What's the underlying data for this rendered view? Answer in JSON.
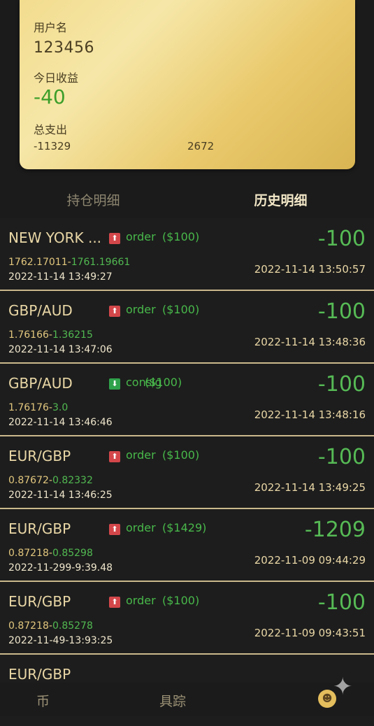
{
  "card": {
    "username_label": "用户名",
    "username_value": "123456",
    "today_label": "今日收益",
    "today_value": "-40",
    "total_expense_label": "总支出",
    "total_expense_value": "-11329",
    "right_value": "2672"
  },
  "tabs": [
    {
      "label": "持仓明细",
      "active": false
    },
    {
      "label": "历史明细",
      "active": true
    }
  ],
  "orders": [
    {
      "symbol": "NEW YORK ...",
      "direction": "up",
      "type": "order",
      "amount": "($100)",
      "open_price": "1762.17011",
      "close_price": "1761.19661",
      "open_time": "2022-11-14 13:49:27",
      "profit": "-100",
      "close_time": "2022-11-14 13:50:57"
    },
    {
      "symbol": "GBP/AUD",
      "direction": "up",
      "type": "order",
      "amount": "($100)",
      "open_price": "1.76166",
      "close_price": "1.36215",
      "open_time": "2022-11-14 13:47:06",
      "profit": "-100",
      "close_time": "2022-11-14 13:48:36"
    },
    {
      "symbol": "GBP/AUD",
      "direction": "down",
      "type": "consig",
      "amount": "($100)",
      "open_price": "1.76176",
      "close_price": "3.0",
      "open_time": "2022-11-14 13:46:46",
      "profit": "-100",
      "close_time": "2022-11-14 13:48:16"
    },
    {
      "symbol": "EUR/GBP",
      "direction": "up",
      "type": "order",
      "amount": "($100)",
      "open_price": "0.87672",
      "close_price": "0.82332",
      "open_time": "2022-11-14 13:46:25",
      "profit": "-100",
      "close_time": "2022-11-14 13:49:25"
    },
    {
      "symbol": "EUR/GBP",
      "direction": "up",
      "type": "order",
      "amount": "($1429)",
      "open_price": "0.87218",
      "close_price": "0.85298",
      "open_time": "2022-11-299-9:39.48",
      "profit": "-1209",
      "close_time": "2022-11-09 09:44:29"
    },
    {
      "symbol": "EUR/GBP",
      "direction": "up",
      "type": "order",
      "amount": "($100)",
      "open_price": "0.87218",
      "close_price": "0.85278",
      "open_time": "2022-11-49-13:93:25",
      "profit": "-100",
      "close_time": "2022-11-09 09:43:51"
    },
    {
      "symbol": "EUR/GBP",
      "direction": "",
      "type": "",
      "amount": "",
      "open_price": "",
      "close_price": "",
      "open_time": "",
      "profit": "",
      "close_time": ""
    }
  ],
  "bottom_nav": {
    "item1": "币",
    "item2": "具踪"
  },
  "colors": {
    "card_gold": "#f2dc8e",
    "profit_green": "#56ba55",
    "up_red": "#d3474a",
    "down_green": "#2fa24b"
  }
}
